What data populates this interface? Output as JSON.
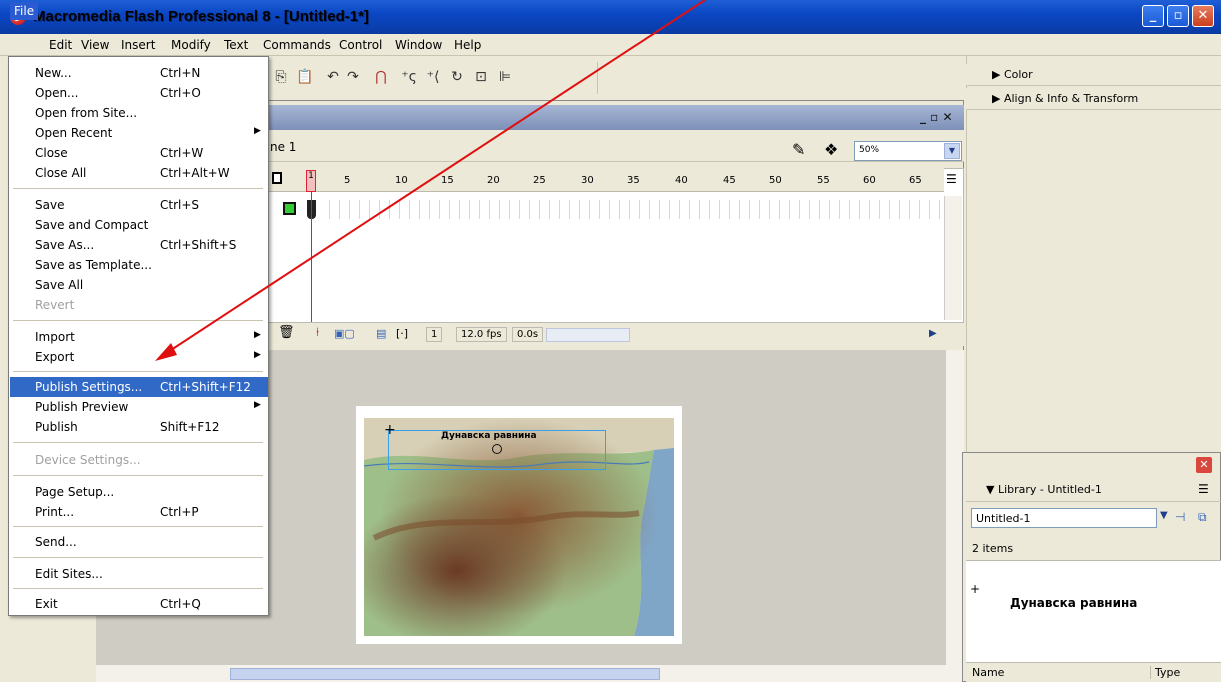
{
  "window": {
    "title": "Macromedia Flash Professional 8 - [Untitled-1*]",
    "icon": "flash-icon",
    "min": "_",
    "max": "▫",
    "close": "✕"
  },
  "menubar": [
    "File",
    "Edit",
    "View",
    "Insert",
    "Modify",
    "Text",
    "Commands",
    "Control",
    "Window",
    "Help"
  ],
  "file_menu": {
    "items": [
      {
        "label": "New...",
        "shortcut": "Ctrl+N"
      },
      {
        "label": "Open...",
        "shortcut": "Ctrl+O"
      },
      {
        "label": "Open from Site...",
        "shortcut": ""
      },
      {
        "label": "Open Recent",
        "shortcut": "",
        "submenu": true
      },
      {
        "label": "Close",
        "shortcut": "Ctrl+W"
      },
      {
        "label": "Close All",
        "shortcut": "Ctrl+Alt+W"
      },
      {
        "label": "Save",
        "shortcut": "Ctrl+S"
      },
      {
        "label": "Save and Compact",
        "shortcut": ""
      },
      {
        "label": "Save As...",
        "shortcut": "Ctrl+Shift+S"
      },
      {
        "label": "Save as Template...",
        "shortcut": ""
      },
      {
        "label": "Save All",
        "shortcut": ""
      },
      {
        "label": "Revert",
        "shortcut": "",
        "disabled": true
      },
      {
        "label": "Import",
        "shortcut": "",
        "submenu": true
      },
      {
        "label": "Export",
        "shortcut": "",
        "submenu": true
      },
      {
        "label": "Publish Settings...",
        "shortcut": "Ctrl+Shift+F12",
        "highlighted": true
      },
      {
        "label": "Publish Preview",
        "shortcut": "",
        "submenu": true
      },
      {
        "label": "Publish",
        "shortcut": "Shift+F12"
      },
      {
        "label": "Device Settings...",
        "shortcut": "",
        "disabled": true
      },
      {
        "label": "Page Setup...",
        "shortcut": ""
      },
      {
        "label": "Print...",
        "shortcut": "Ctrl+P"
      },
      {
        "label": "Send...",
        "shortcut": ""
      },
      {
        "label": "Edit Sites...",
        "shortcut": ""
      },
      {
        "label": "Exit",
        "shortcut": "Ctrl+Q"
      }
    ]
  },
  "document": {
    "scene": "ne 1",
    "zoom": "50%",
    "controls": "_ ▫ ✕"
  },
  "timeline": {
    "frame_numbers": [
      "1",
      "5",
      "10",
      "15",
      "20",
      "25",
      "30",
      "35",
      "40",
      "45",
      "50",
      "55",
      "60",
      "65"
    ],
    "current_frame": "1",
    "fps": "12.0 fps",
    "time": "0.0s"
  },
  "stage": {
    "map_label": "Дунавска равнина"
  },
  "panels": {
    "color": "Color",
    "align": "Align & Info & Transform"
  },
  "library": {
    "title": "Library - Untitled-1",
    "selected": "Untitled-1",
    "count": "2 items",
    "preview_text": "Дунавска равнина",
    "columns": [
      "Name",
      "Type"
    ]
  },
  "annotation": {
    "color": "#e01010"
  }
}
